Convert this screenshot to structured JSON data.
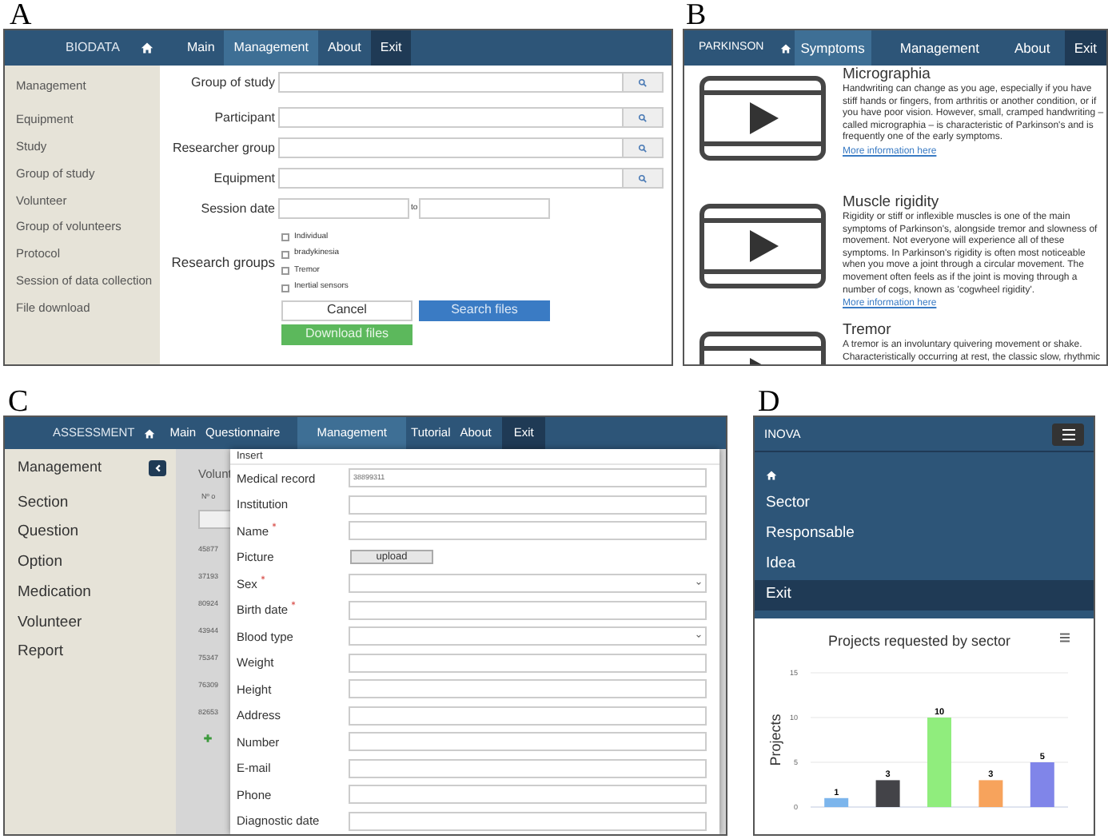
{
  "panel_a": {
    "label": "A",
    "navbar": {
      "brand": "BIODATA",
      "items": [
        {
          "label": "Main",
          "selected": false,
          "kind": "link"
        },
        {
          "label": "Management",
          "selected": true,
          "kind": "link"
        },
        {
          "label": "About",
          "selected": false,
          "kind": "link"
        },
        {
          "label": "Exit",
          "selected": false,
          "kind": "exit"
        }
      ]
    },
    "sidebar": {
      "title": "Management",
      "items": [
        "Equipment",
        "Study",
        "Group of study",
        "Volunteer",
        "Group of volunteers",
        "Protocol",
        "Session of data collection",
        "File download"
      ]
    },
    "form": {
      "search_fields": [
        "Group of study",
        "Participant",
        "Researcher group",
        "Equipment"
      ],
      "session_date": {
        "label": "Session date",
        "separator": "to"
      },
      "research_groups": {
        "label": "Research groups",
        "options": [
          {
            "label": "Individual",
            "checked": false
          },
          {
            "label": "bradykinesia",
            "checked": false
          },
          {
            "label": "Tremor",
            "checked": false
          },
          {
            "label": "Inertial sensors",
            "checked": false
          }
        ]
      },
      "buttons": [
        {
          "label": "Cancel",
          "kind": "default"
        },
        {
          "label": "Search files",
          "kind": "primary"
        },
        {
          "label": "Download files",
          "kind": "success"
        }
      ]
    }
  },
  "panel_b": {
    "label": "B",
    "navbar": {
      "brand": "PARKINSON",
      "items": [
        {
          "label": "Symptoms",
          "selected": true,
          "kind": "link"
        },
        {
          "label": "Management",
          "selected": false,
          "kind": "link"
        },
        {
          "label": "About",
          "selected": false,
          "kind": "link"
        },
        {
          "label": "Exit",
          "selected": false,
          "kind": "exit"
        }
      ]
    },
    "symptoms": [
      {
        "title": "Micrographia",
        "text": "Handwriting can change as you age, especially if you have stiff hands or fingers, from arthritis or another condition, or if you have poor vision. However, small, cramped handwriting – called micrographia – is characteristic of Parkinson's and is frequently one of the early symptoms.",
        "link": "More information here"
      },
      {
        "title": "Muscle rigidity",
        "text": "Rigidity or stiff or inflexible muscles is one of the main symptoms of Parkinson's, alongside tremor and slowness of movement. Not everyone will experience all of these symptoms. In Parkinson's rigidity is often most noticeable when you move a joint through a circular movement. The movement often feels as if the joint is moving through a number of cogs, known as 'cogwheel rigidity'.",
        "link": "More information here"
      },
      {
        "title": "Tremor",
        "text": "A tremor is an involuntary quivering movement or shake. Characteristically occurring at rest, the classic slow, rhythmic"
      }
    ]
  },
  "panel_c": {
    "label": "C",
    "navbar": {
      "brand": "ASSESSMENT",
      "items": [
        {
          "label": "Main",
          "selected": false,
          "kind": "link"
        },
        {
          "label": "Questionnaire",
          "selected": false,
          "kind": "link"
        },
        {
          "label": "Management",
          "selected": true,
          "kind": "link"
        },
        {
          "label": "Tutorial",
          "selected": false,
          "kind": "link"
        },
        {
          "label": "About",
          "selected": false,
          "kind": "link"
        },
        {
          "label": "Exit",
          "selected": false,
          "kind": "exit"
        }
      ]
    },
    "sidebar": {
      "title": "Management",
      "items": [
        "Section",
        "Question",
        "Option",
        "Medication",
        "Volunteer",
        "Report"
      ]
    },
    "table": {
      "title": "Volunt",
      "column_1": "Nº o",
      "rows": [
        "45877",
        "37193",
        "80924",
        "43944",
        "75347",
        "76309",
        "82653"
      ]
    },
    "dialog": {
      "title": "Insert",
      "fields": [
        {
          "label": "Medical record",
          "kind": "text",
          "required": false,
          "value": "38899311"
        },
        {
          "label": "Institution",
          "kind": "text",
          "required": false
        },
        {
          "label": "Name",
          "kind": "text",
          "required": true
        },
        {
          "label": "Picture",
          "kind": "upload",
          "required": false,
          "button": "upload"
        },
        {
          "label": "Sex",
          "kind": "select",
          "required": true
        },
        {
          "label": "Birth date",
          "kind": "text",
          "required": true
        },
        {
          "label": "Blood type",
          "kind": "select",
          "required": false
        },
        {
          "label": "Weight",
          "kind": "text",
          "required": false
        },
        {
          "label": "Height",
          "kind": "text",
          "required": false
        },
        {
          "label": "Address",
          "kind": "text",
          "required": false
        },
        {
          "label": "Number",
          "kind": "text",
          "required": false
        },
        {
          "label": "E-mail",
          "kind": "text",
          "required": false
        },
        {
          "label": "Phone",
          "kind": "text",
          "required": false
        },
        {
          "label": "Diagnostic date",
          "kind": "text",
          "required": false
        }
      ]
    }
  },
  "panel_d": {
    "label": "D",
    "navbar": {
      "brand": "INOVA"
    },
    "menu": [
      {
        "label": "Sector",
        "kind": "link"
      },
      {
        "label": "Responsable",
        "kind": "link"
      },
      {
        "label": "Idea",
        "kind": "link"
      },
      {
        "label": "Exit",
        "kind": "exit"
      }
    ],
    "chart_data": {
      "type": "bar",
      "title": "Projects requested by sector",
      "ylabel": "Projects",
      "ylim": [
        0,
        15
      ],
      "yticks": [
        0,
        5,
        10,
        15
      ],
      "data_labels": true,
      "series": [
        {
          "values": [
            1,
            3,
            10,
            3,
            5
          ]
        }
      ],
      "colors": [
        "#7cb5ec",
        "#434348",
        "#90ed7d",
        "#f7a35c",
        "#8085e9"
      ]
    }
  }
}
